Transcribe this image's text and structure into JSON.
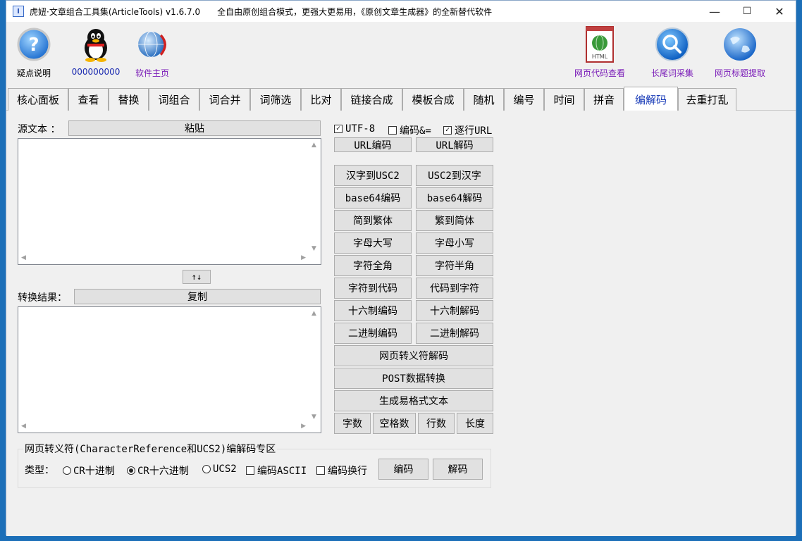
{
  "window": {
    "title": "虎妞·文章组合工具集(ArticleTools) v1.6.7.0",
    "slogan": "全自由原创组合模式，更强大更易用，《原创文章生成器》的全新替代软件",
    "minimize": "—",
    "maximize": "☐",
    "close": "✕"
  },
  "toolbar": {
    "help_label": "疑点说明",
    "qq_label": "000000000",
    "home_label": "软件主页",
    "code_view_label": "网页代码查看",
    "longtail_label": "长尾词采集",
    "title_extract_label": "网页标题提取"
  },
  "tabs": [
    {
      "label": "核心面板"
    },
    {
      "label": "查看"
    },
    {
      "label": "替换"
    },
    {
      "label": "词组合"
    },
    {
      "label": "词合并"
    },
    {
      "label": "词筛选"
    },
    {
      "label": "比对"
    },
    {
      "label": "链接合成"
    },
    {
      "label": "模板合成"
    },
    {
      "label": "随机"
    },
    {
      "label": "编号"
    },
    {
      "label": "时间"
    },
    {
      "label": "拼音"
    },
    {
      "label": "编解码"
    },
    {
      "label": "去重打乱"
    }
  ],
  "active_tab": "编解码",
  "source": {
    "label": "源文本 ：",
    "paste_button": "粘贴",
    "value": ""
  },
  "swap_button": "↑↓",
  "result": {
    "label": "转换结果：",
    "copy_button": "复制",
    "value": ""
  },
  "options": {
    "utf8": {
      "label": "UTF-8",
      "checked": true
    },
    "encode_amp": {
      "label": "编码&=",
      "checked": false
    },
    "per_line_url": {
      "label": "逐行URL",
      "checked": true
    }
  },
  "buttons": {
    "url_encode": "URL编码",
    "url_decode": "URL解码",
    "hanzi_to_usc2": "汉字到USC2",
    "usc2_to_hanzi": "USC2到汉字",
    "base64_encode": "base64编码",
    "base64_decode": "base64解码",
    "simp_to_trad": "简到繁体",
    "trad_to_simp": "繁到简体",
    "upper": "字母大写",
    "lower": "字母小写",
    "fullwidth": "字符全角",
    "halfwidth": "字符半角",
    "char_to_code": "字符到代码",
    "code_to_char": "代码到字符",
    "hex_encode": "十六制编码",
    "hex_decode": "十六制解码",
    "bin_encode": "二进制编码",
    "bin_decode": "二进制解码",
    "html_entity_decode": "网页转义符解码",
    "post_convert": "POST数据转换",
    "easy_format": "生成易格式文本",
    "char_count": "字数",
    "space_count": "空格数",
    "line_count": "行数",
    "length": "长度"
  },
  "charref": {
    "group_title": "网页转义符(CharacterReference和UCS2)编解码专区",
    "type_label": "类型：",
    "radio_cr_dec": {
      "label": "CR十进制",
      "selected": false
    },
    "radio_cr_hex": {
      "label": "CR十六进制",
      "selected": true
    },
    "radio_ucs2": {
      "label": "UCS2",
      "selected": false
    },
    "chk_ascii": {
      "label": "编码ASCII",
      "checked": false
    },
    "chk_newline": {
      "label": "编码换行",
      "checked": false
    },
    "encode_button": "编码",
    "decode_button": "解码"
  }
}
